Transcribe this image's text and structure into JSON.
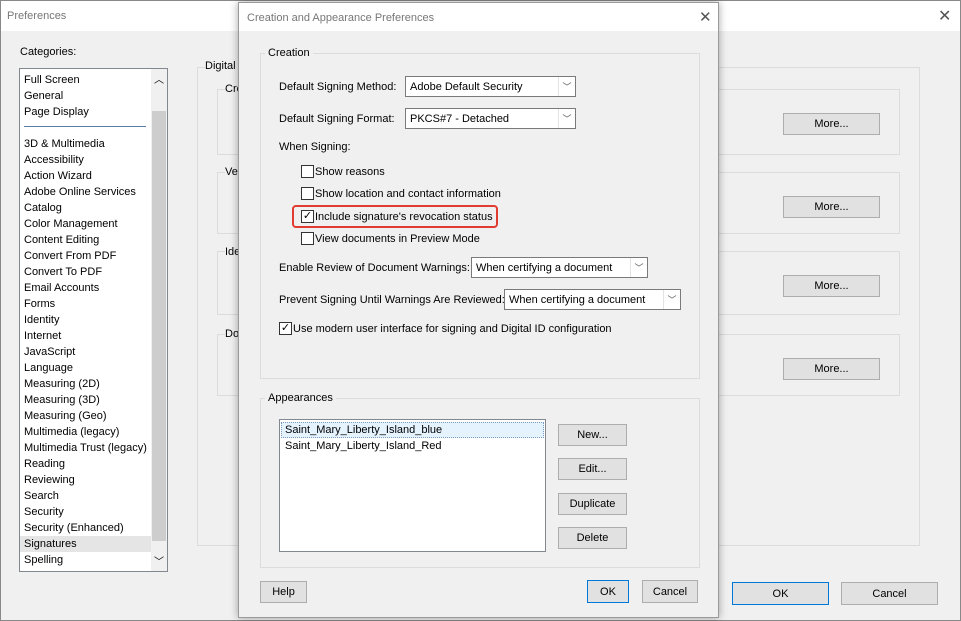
{
  "main_window": {
    "title": "Preferences",
    "categories_label": "Categories:",
    "categories_top": [
      "Full Screen",
      "General",
      "Page Display"
    ],
    "categories": [
      "3D & Multimedia",
      "Accessibility",
      "Action Wizard",
      "Adobe Online Services",
      "Catalog",
      "Color Management",
      "Content Editing",
      "Convert From PDF",
      "Convert To PDF",
      "Email Accounts",
      "Forms",
      "Identity",
      "Internet",
      "JavaScript",
      "Language",
      "Measuring (2D)",
      "Measuring (3D)",
      "Measuring (Geo)",
      "Multimedia (legacy)",
      "Multimedia Trust (legacy)",
      "Reading",
      "Reviewing",
      "Search",
      "Security",
      "Security (Enhanced)",
      "Signatures",
      "Spelling"
    ],
    "selected_category": "Signatures",
    "section_label": "Digital S",
    "group_fragments": [
      "Cre",
      "Ver",
      "Ide",
      "Do"
    ],
    "more_label": "More...",
    "ok_label": "OK",
    "cancel_label": "Cancel"
  },
  "dialog": {
    "title": "Creation and Appearance Preferences",
    "creation_label": "Creation",
    "default_method_label": "Default Signing Method:",
    "default_method_value": "Adobe Default Security",
    "default_format_label": "Default Signing Format:",
    "default_format_value": "PKCS#7 - Detached",
    "when_signing_label": "When Signing:",
    "show_reasons": "Show reasons",
    "show_location": "Show location and contact information",
    "include_revocation": "Include signature's revocation status",
    "view_preview": "View documents in Preview Mode",
    "enable_review_label": "Enable Review of Document Warnings:",
    "enable_review_value": "When certifying a document",
    "prevent_signing_label": "Prevent Signing Until Warnings Are Reviewed:",
    "prevent_signing_value": "When certifying a document",
    "modern_ui_label": "Use modern user interface for signing and Digital ID configuration",
    "appearances_label": "Appearances",
    "appearances": [
      "Saint_Mary_Liberty_Island_blue",
      "Saint_Mary_Liberty_Island_Red"
    ],
    "new_label": "New...",
    "edit_label": "Edit...",
    "duplicate_label": "Duplicate",
    "delete_label": "Delete",
    "help_label": "Help",
    "ok_label": "OK",
    "cancel_label": "Cancel",
    "checked": {
      "show_reasons": false,
      "show_location": false,
      "include_revocation": true,
      "view_preview": false,
      "modern_ui": true
    },
    "highlight_color": "#e03c31"
  }
}
